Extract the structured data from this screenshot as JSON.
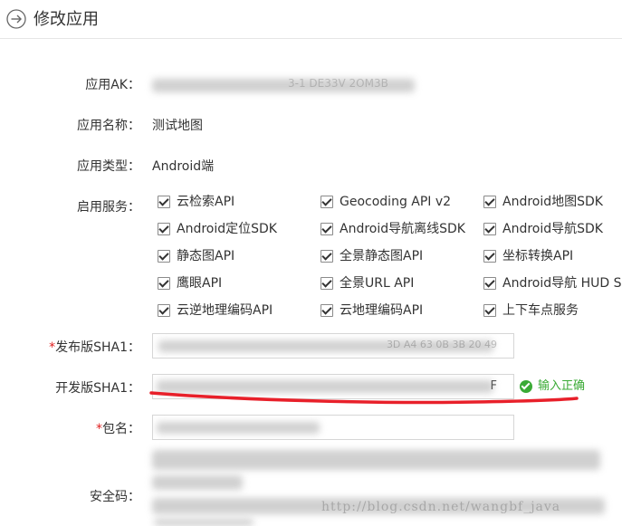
{
  "header": {
    "title": "修改应用",
    "back_icon": "circle-arrow-right-icon"
  },
  "form": {
    "ak_label": "应用AK：",
    "ak_value_tail": "3-1 DE33V 2OM3B",
    "name_label": "应用名称：",
    "name_value": "测试地图",
    "type_label": "应用类型：",
    "type_value": "Android端",
    "services_label": "启用服务：",
    "services": [
      [
        "云检索API",
        "Geocoding API v2",
        "Android地图SDK"
      ],
      [
        "Android定位SDK",
        "Android导航离线SDK",
        "Android导航SDK"
      ],
      [
        "静态图API",
        "全景静态图API",
        "坐标转换API"
      ],
      [
        "鹰眼API",
        "全景URL API",
        "Android导航 HUD SDK"
      ],
      [
        "云逆地理编码API",
        "云地理编码API",
        "上下车点服务"
      ]
    ],
    "required_mark": "*",
    "release_sha1_label": "发布版SHA1：",
    "release_sha1_tail": "3D A4 63 0B 3B 20 49",
    "dev_sha1_label": "开发版SHA1：",
    "dev_sha1_tail": "F",
    "dev_sha1_status": "输入正确",
    "package_label": "包名：",
    "security_label": "安全码："
  },
  "watermark": "http://blog.csdn.net/wangbf_java",
  "colors": {
    "ok_green": "#3aaa35",
    "annotation_red": "#e8202a",
    "required_red": "#e02020"
  }
}
